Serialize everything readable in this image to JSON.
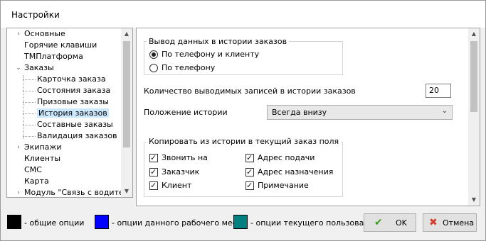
{
  "window": {
    "title": "Настройки"
  },
  "tree": {
    "items": [
      {
        "label": "Основные",
        "level": 0,
        "expander": "›"
      },
      {
        "label": "Горячие клавиши",
        "level": 0,
        "expander": ""
      },
      {
        "label": "ТМПлатформа",
        "level": 0,
        "expander": ""
      },
      {
        "label": "Заказы",
        "level": 0,
        "expander": "⌄"
      },
      {
        "label": "Карточка заказа",
        "level": 1,
        "expander": ""
      },
      {
        "label": "Состояния заказа",
        "level": 1,
        "expander": ""
      },
      {
        "label": "Призовые заказы",
        "level": 1,
        "expander": ""
      },
      {
        "label": "История заказов",
        "level": 1,
        "expander": "",
        "selected": true
      },
      {
        "label": "Составные заказы",
        "level": 1,
        "expander": ""
      },
      {
        "label": "Валидация заказов",
        "level": 1,
        "expander": ""
      },
      {
        "label": "Экипажи",
        "level": 0,
        "expander": "›"
      },
      {
        "label": "Клиенты",
        "level": 0,
        "expander": ""
      },
      {
        "label": "СМС",
        "level": 0,
        "expander": ""
      },
      {
        "label": "Карта",
        "level": 0,
        "expander": ""
      },
      {
        "label": "Модуль \"Связь с водителя",
        "level": 0,
        "expander": "›"
      }
    ]
  },
  "content": {
    "history_output": {
      "caption": "Вывод данных в истории заказов",
      "options": [
        {
          "label": "По телефону и клиенту",
          "checked": true
        },
        {
          "label": "По телефону",
          "checked": false
        }
      ]
    },
    "records_count": {
      "label": "Количество выводимых записей в истории заказов",
      "value": "20"
    },
    "history_position": {
      "label": "Положение истории",
      "value": "Всегда внизу"
    },
    "copy_fields": {
      "caption": "Копировать из истории в текущий заказ поля",
      "left": [
        {
          "label": "Звонить на",
          "checked": true
        },
        {
          "label": "Заказчик",
          "checked": true
        },
        {
          "label": "Клиент",
          "checked": true
        }
      ],
      "right": [
        {
          "label": "Адрес подачи",
          "checked": true
        },
        {
          "label": "Адрес назначения",
          "checked": true
        },
        {
          "label": "Примечание",
          "checked": true
        }
      ]
    }
  },
  "legend": [
    {
      "color": "#000000",
      "label": "- общие опции"
    },
    {
      "color": "#0000ff",
      "label": "- опции данного рабочего места"
    },
    {
      "color": "#008080",
      "label": "- опции текущего пользователя"
    }
  ],
  "buttons": {
    "ok": "OK",
    "cancel": "Отмена"
  },
  "colors": {
    "ok_icon": "#3a9a1a",
    "cancel_icon": "#d43c2c",
    "selection": "#cce8ff"
  }
}
